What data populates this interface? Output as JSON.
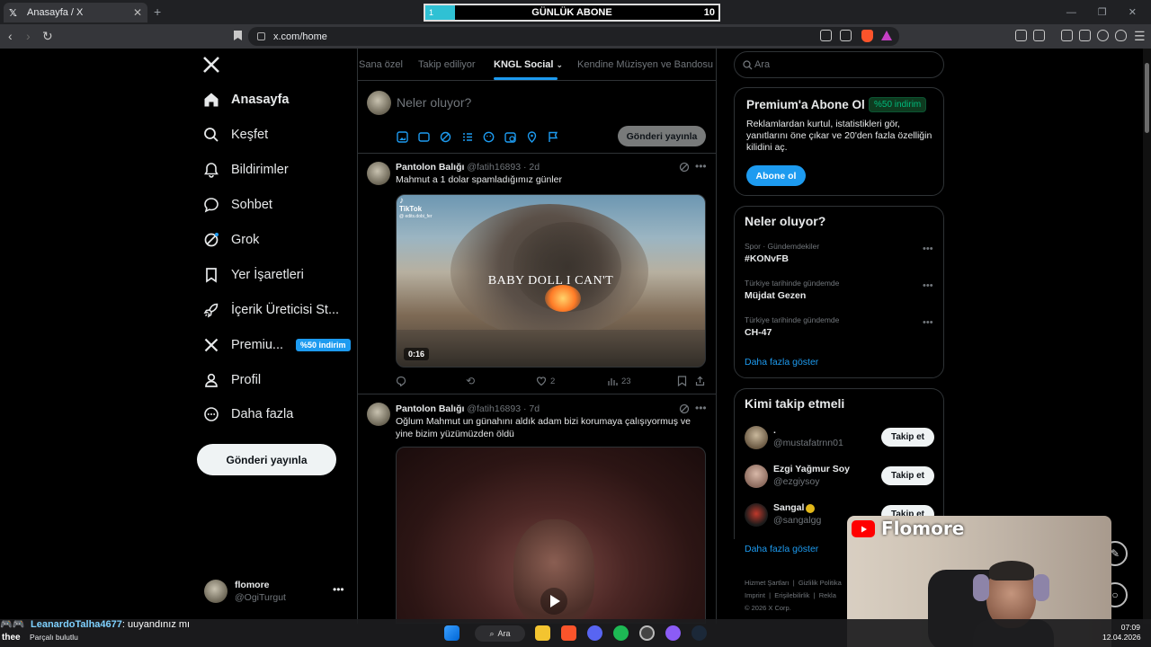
{
  "browser": {
    "tab_title": "Anasayfa / X",
    "url": "x.com/home"
  },
  "sub_counter": {
    "start": "1",
    "title": "GÜNLÜK ABONE",
    "goal": "10",
    "progress": 0.1
  },
  "nav": {
    "items": [
      {
        "label": "Anasayfa",
        "icon": "home-icon"
      },
      {
        "label": "Keşfet",
        "icon": "search-icon"
      },
      {
        "label": "Bildirimler",
        "icon": "bell-icon"
      },
      {
        "label": "Sohbet",
        "icon": "chat-bubble-icon"
      },
      {
        "label": "Grok",
        "icon": "grok-icon"
      },
      {
        "label": "Yer İşaretleri",
        "icon": "bookmark-icon"
      },
      {
        "label": "İçerik Üreticisi St...",
        "icon": "rocket-icon"
      },
      {
        "label": "Premiu...",
        "icon": "x-logo-icon",
        "badge": "%50 indirim"
      },
      {
        "label": "Profil",
        "icon": "person-icon"
      },
      {
        "label": "Daha fazla",
        "icon": "more-circle-icon"
      }
    ],
    "post_button": "Gönderi yayınla",
    "account": {
      "name": "flomore",
      "handle": "@OgiTurgut"
    }
  },
  "feed": {
    "tabs": [
      "Sana özel",
      "Takip ediliyor",
      "KNGL Social",
      "Kendine Müzisyen ve Bandosu"
    ],
    "active_tab": "KNGL Social",
    "composer_placeholder": "Neler oluyor?",
    "composer_post": "Gönderi yayınla",
    "posts": [
      {
        "name": "Pantolon Balığı",
        "handle": "@fatih16893 · 2d",
        "text": "Mahmut a 1 dolar spamladığımız günler",
        "media_caption": "BABY DOLL I CAN'T",
        "tiktok": "TikTok",
        "tiktok_handle": "@ edits.dobi_fer",
        "duration": "0:16",
        "likes": "2",
        "views": "23"
      },
      {
        "name": "Pantolon Balığı",
        "handle": "@fatih16893 · 7d",
        "text": "Oğlum Mahmut un günahını aldık adam bizi korumaya çalışıyormuş ve yine bizim yüzümüzden öldü"
      }
    ]
  },
  "right": {
    "search_placeholder": "Ara",
    "premium": {
      "title": "Premium'a Abone Ol",
      "badge": "%50 indirim",
      "desc": "Reklamlardan kurtul, istatistikleri gör, yanıtlarını öne çıkar ve 20'den fazla özelliğin kilidini aç.",
      "button": "Abone ol"
    },
    "trends": {
      "title": "Neler oluyor?",
      "items": [
        {
          "context": "Spor · Gündemdekiler",
          "name": "#KONvFB"
        },
        {
          "context": "Türkiye tarihinde gündemde",
          "name": "Müjdat Gezen"
        },
        {
          "context": "Türkiye tarihinde gündemde",
          "name": "CH-47"
        }
      ],
      "show_more": "Daha fazla göster"
    },
    "who_to_follow": {
      "title": "Kimi takip etmeli",
      "items": [
        {
          "name": ".",
          "handle": "@mustafatrnn01",
          "button": "Takip et"
        },
        {
          "name": "Ezgi Yağmur Soy",
          "handle": "@ezgiysoy",
          "button": "Takip et"
        },
        {
          "name": "Sangal",
          "handle": "@sangalgg",
          "button": "Takip et"
        }
      ],
      "show_more": "Daha fazla göster"
    },
    "footer": [
      "Hizmet Şartları",
      "Gizlilik Politika",
      "Imprint",
      "Erişilebilirlik",
      "Rekla",
      "© 2026 X Corp."
    ]
  },
  "overlay": {
    "webcam_name": "Flomore",
    "chat_user": "LeanardoTalha4677",
    "chat_msg": ": uuyandınız mı",
    "chat_prefix": "thee",
    "weather": "Parçalı bulutlu"
  },
  "taskbar": {
    "search": "Ara",
    "time": "07:09",
    "date": "12.04.2026"
  }
}
